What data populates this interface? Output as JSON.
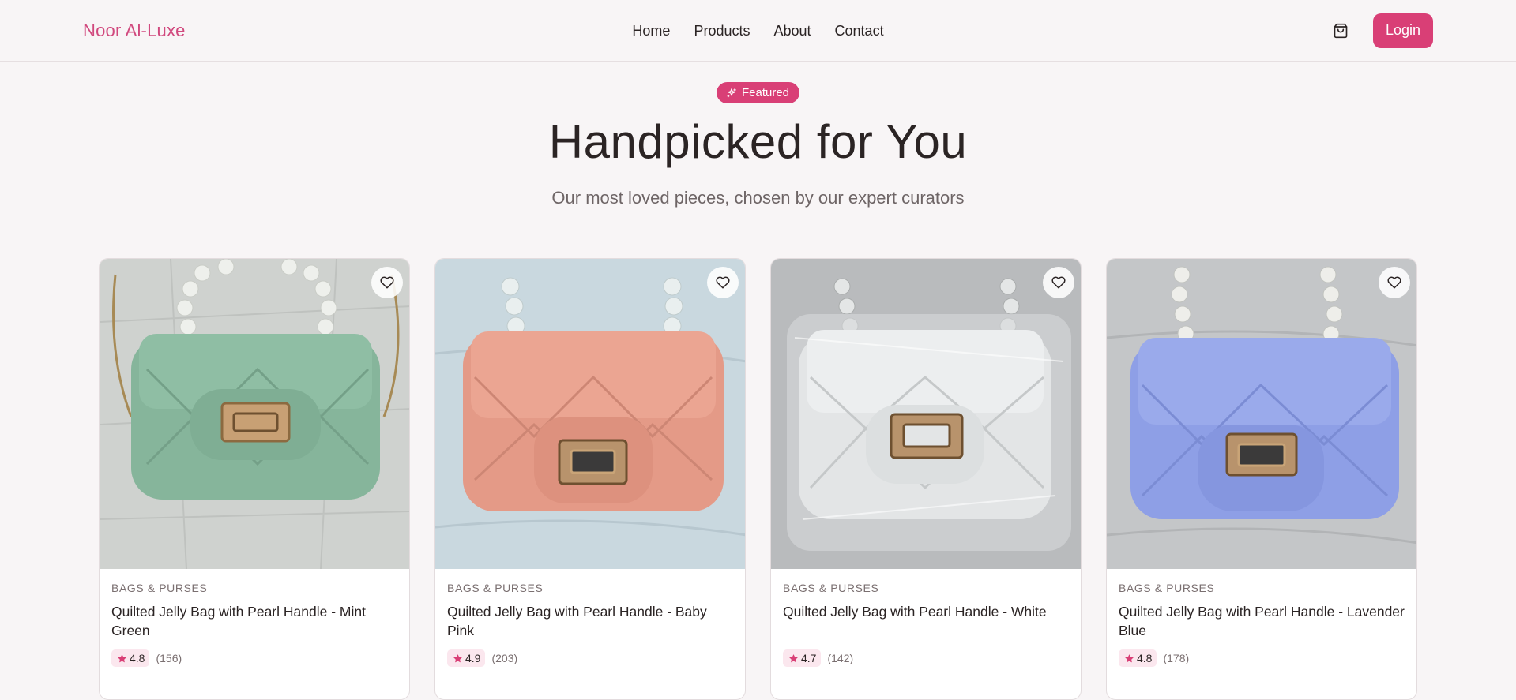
{
  "header": {
    "brand": "Noor Al-Luxe",
    "nav": [
      "Home",
      "Products",
      "About",
      "Contact"
    ],
    "login_label": "Login",
    "cart_icon": "shopping-bag-icon"
  },
  "hero": {
    "badge": "Featured",
    "title": "Handpicked for You",
    "subtitle": "Our most loved pieces, chosen by our expert curators"
  },
  "products": [
    {
      "category": "BAGS & PURSES",
      "name": "Quilted Jelly Bag with Pearl Handle - Mint Green",
      "rating": "4.8",
      "reviews": "(156)",
      "color": "#86b59b"
    },
    {
      "category": "BAGS & PURSES",
      "name": "Quilted Jelly Bag with Pearl Handle - Baby Pink",
      "rating": "4.9",
      "reviews": "(203)",
      "color": "#e49a87"
    },
    {
      "category": "BAGS & PURSES",
      "name": "Quilted Jelly Bag with Pearl Handle - White",
      "rating": "4.7",
      "reviews": "(142)",
      "color": "#e3e5e6"
    },
    {
      "category": "BAGS & PURSES",
      "name": "Quilted Jelly Bag with Pearl Handle - Lavender Blue",
      "rating": "4.8",
      "reviews": "(178)",
      "color": "#8e9fe6"
    }
  ],
  "colors": {
    "accent": "#d93f76",
    "brand": "#d1497e",
    "background": "#f8f5f6"
  }
}
